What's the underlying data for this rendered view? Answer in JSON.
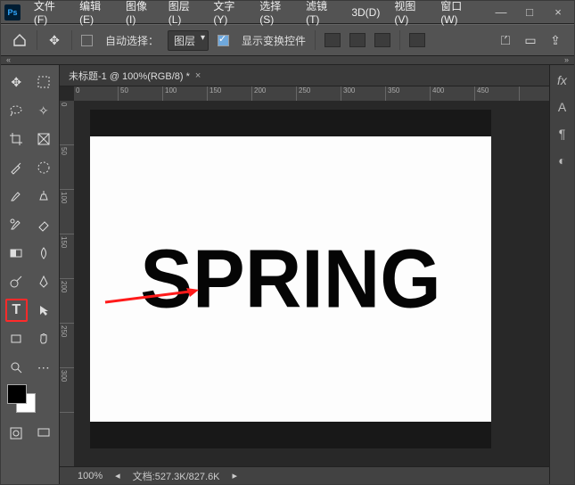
{
  "app": {
    "logo": "Ps"
  },
  "menubar": {
    "items": [
      "文件(F)",
      "编辑(E)",
      "图像(I)",
      "图层(L)",
      "文字(Y)",
      "选择(S)",
      "滤镜(T)",
      "3D(D)",
      "视图(V)",
      "窗口(W)"
    ]
  },
  "window_controls": {
    "minimize": "—",
    "maximize": "□",
    "close": "×"
  },
  "optionbar": {
    "auto_select_label": "自动选择：",
    "auto_select_value": "图层",
    "show_transform_label": "显示变换控件"
  },
  "document_tab": {
    "title": "未标题-1 @ 100%(RGB/8) *"
  },
  "ruler_h": [
    "0",
    "50",
    "100",
    "150",
    "200",
    "250",
    "300",
    "350",
    "400",
    "450"
  ],
  "ruler_v": [
    "0",
    "50",
    "100",
    "150",
    "200",
    "250",
    "300"
  ],
  "canvas_text": "SPRING",
  "status": {
    "zoom": "100%",
    "docinfo_label": "文档:",
    "docinfo_value": "527.3K/827.6K"
  },
  "tool_text_glyph": "T",
  "right_panel": {
    "fx": "fx",
    "char": "A",
    "para": "¶",
    "adj": "◐"
  }
}
